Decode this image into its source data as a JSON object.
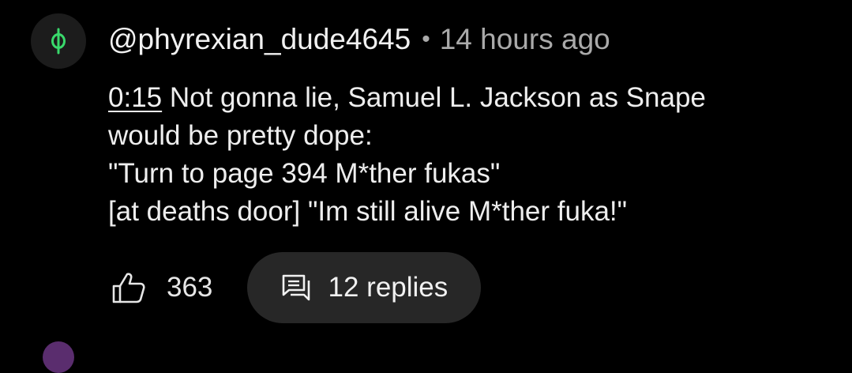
{
  "comment": {
    "avatar_icon": "phi-glyph-icon",
    "handle": "@phyrexian_dude4645",
    "separator": "•",
    "time": "14 hours ago",
    "timestamp_link": "0:15",
    "lines": [
      " Not gonna lie, Samuel L. Jackson as Snape",
      "would be pretty dope:",
      "\"Turn to page 394 M*ther fukas\"",
      "[at deaths door] \"Im still alive M*ther fuka!\""
    ],
    "likes": "363",
    "replies_label": "12 replies",
    "like_icon": "thumbs-up-icon",
    "replies_icon": "replies-icon"
  },
  "colors": {
    "background": "#000000",
    "avatar_glyph": "#39d96b",
    "button_bg": "#272727",
    "secondary_text": "#aaaaaa"
  }
}
